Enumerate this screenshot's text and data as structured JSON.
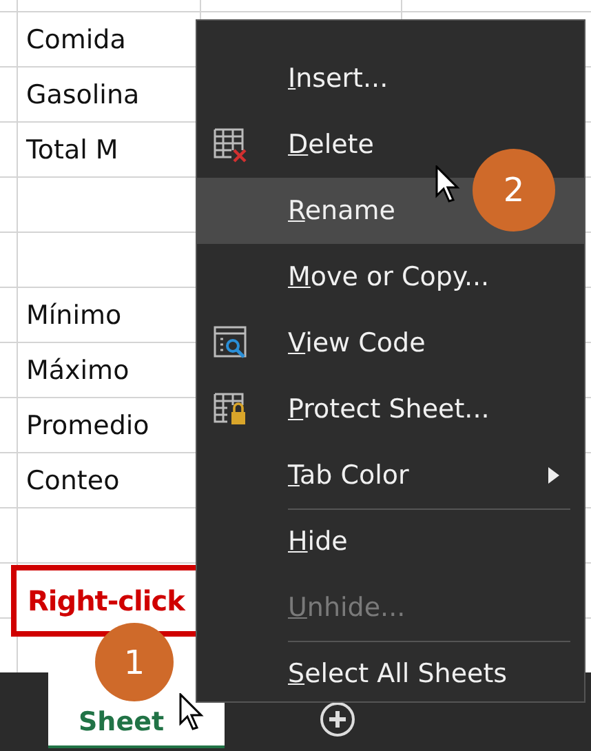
{
  "sheet": {
    "rows": [
      {
        "column_1": "Comida"
      },
      {
        "column_1": "Gasolina"
      },
      {
        "column_1": "Total M"
      },
      {},
      {},
      {
        "column_1": "Mínimo"
      },
      {
        "column_1": "Máximo"
      },
      {
        "column_1": "Promedio"
      },
      {
        "column_1": "Conteo"
      },
      {},
      {},
      {}
    ]
  },
  "sheet_tabs": [
    {
      "label": "Sheet",
      "selected": true
    }
  ],
  "context_menu": {
    "items": [
      {
        "label": "Insert...",
        "highlighted": false,
        "disabled": false,
        "submenu": false,
        "separator_before": false
      },
      {
        "label": "Delete",
        "highlighted": false,
        "disabled": false,
        "submenu": false,
        "separator_before": false
      },
      {
        "label": "Rename",
        "highlighted": true,
        "disabled": false,
        "submenu": false,
        "separator_before": false
      },
      {
        "label": "Move or Copy...",
        "highlighted": false,
        "disabled": false,
        "submenu": false,
        "separator_before": false
      },
      {
        "label": "View Code",
        "highlighted": false,
        "disabled": false,
        "submenu": false,
        "separator_before": false
      },
      {
        "label": "Protect Sheet...",
        "highlighted": false,
        "disabled": false,
        "submenu": false,
        "separator_before": false
      },
      {
        "label": "Tab Color",
        "highlighted": false,
        "disabled": false,
        "submenu": true,
        "separator_before": false
      },
      {
        "label": "Hide",
        "highlighted": false,
        "disabled": false,
        "submenu": false,
        "separator_before": true
      },
      {
        "label": "Unhide...",
        "highlighted": false,
        "disabled": true,
        "submenu": false,
        "separator_before": false
      },
      {
        "label": "Select All Sheets",
        "highlighted": false,
        "disabled": false,
        "submenu": false,
        "separator_before": true
      }
    ]
  },
  "annotations": {
    "callout": "Right-click",
    "step_badges": [
      "1",
      "2"
    ]
  }
}
